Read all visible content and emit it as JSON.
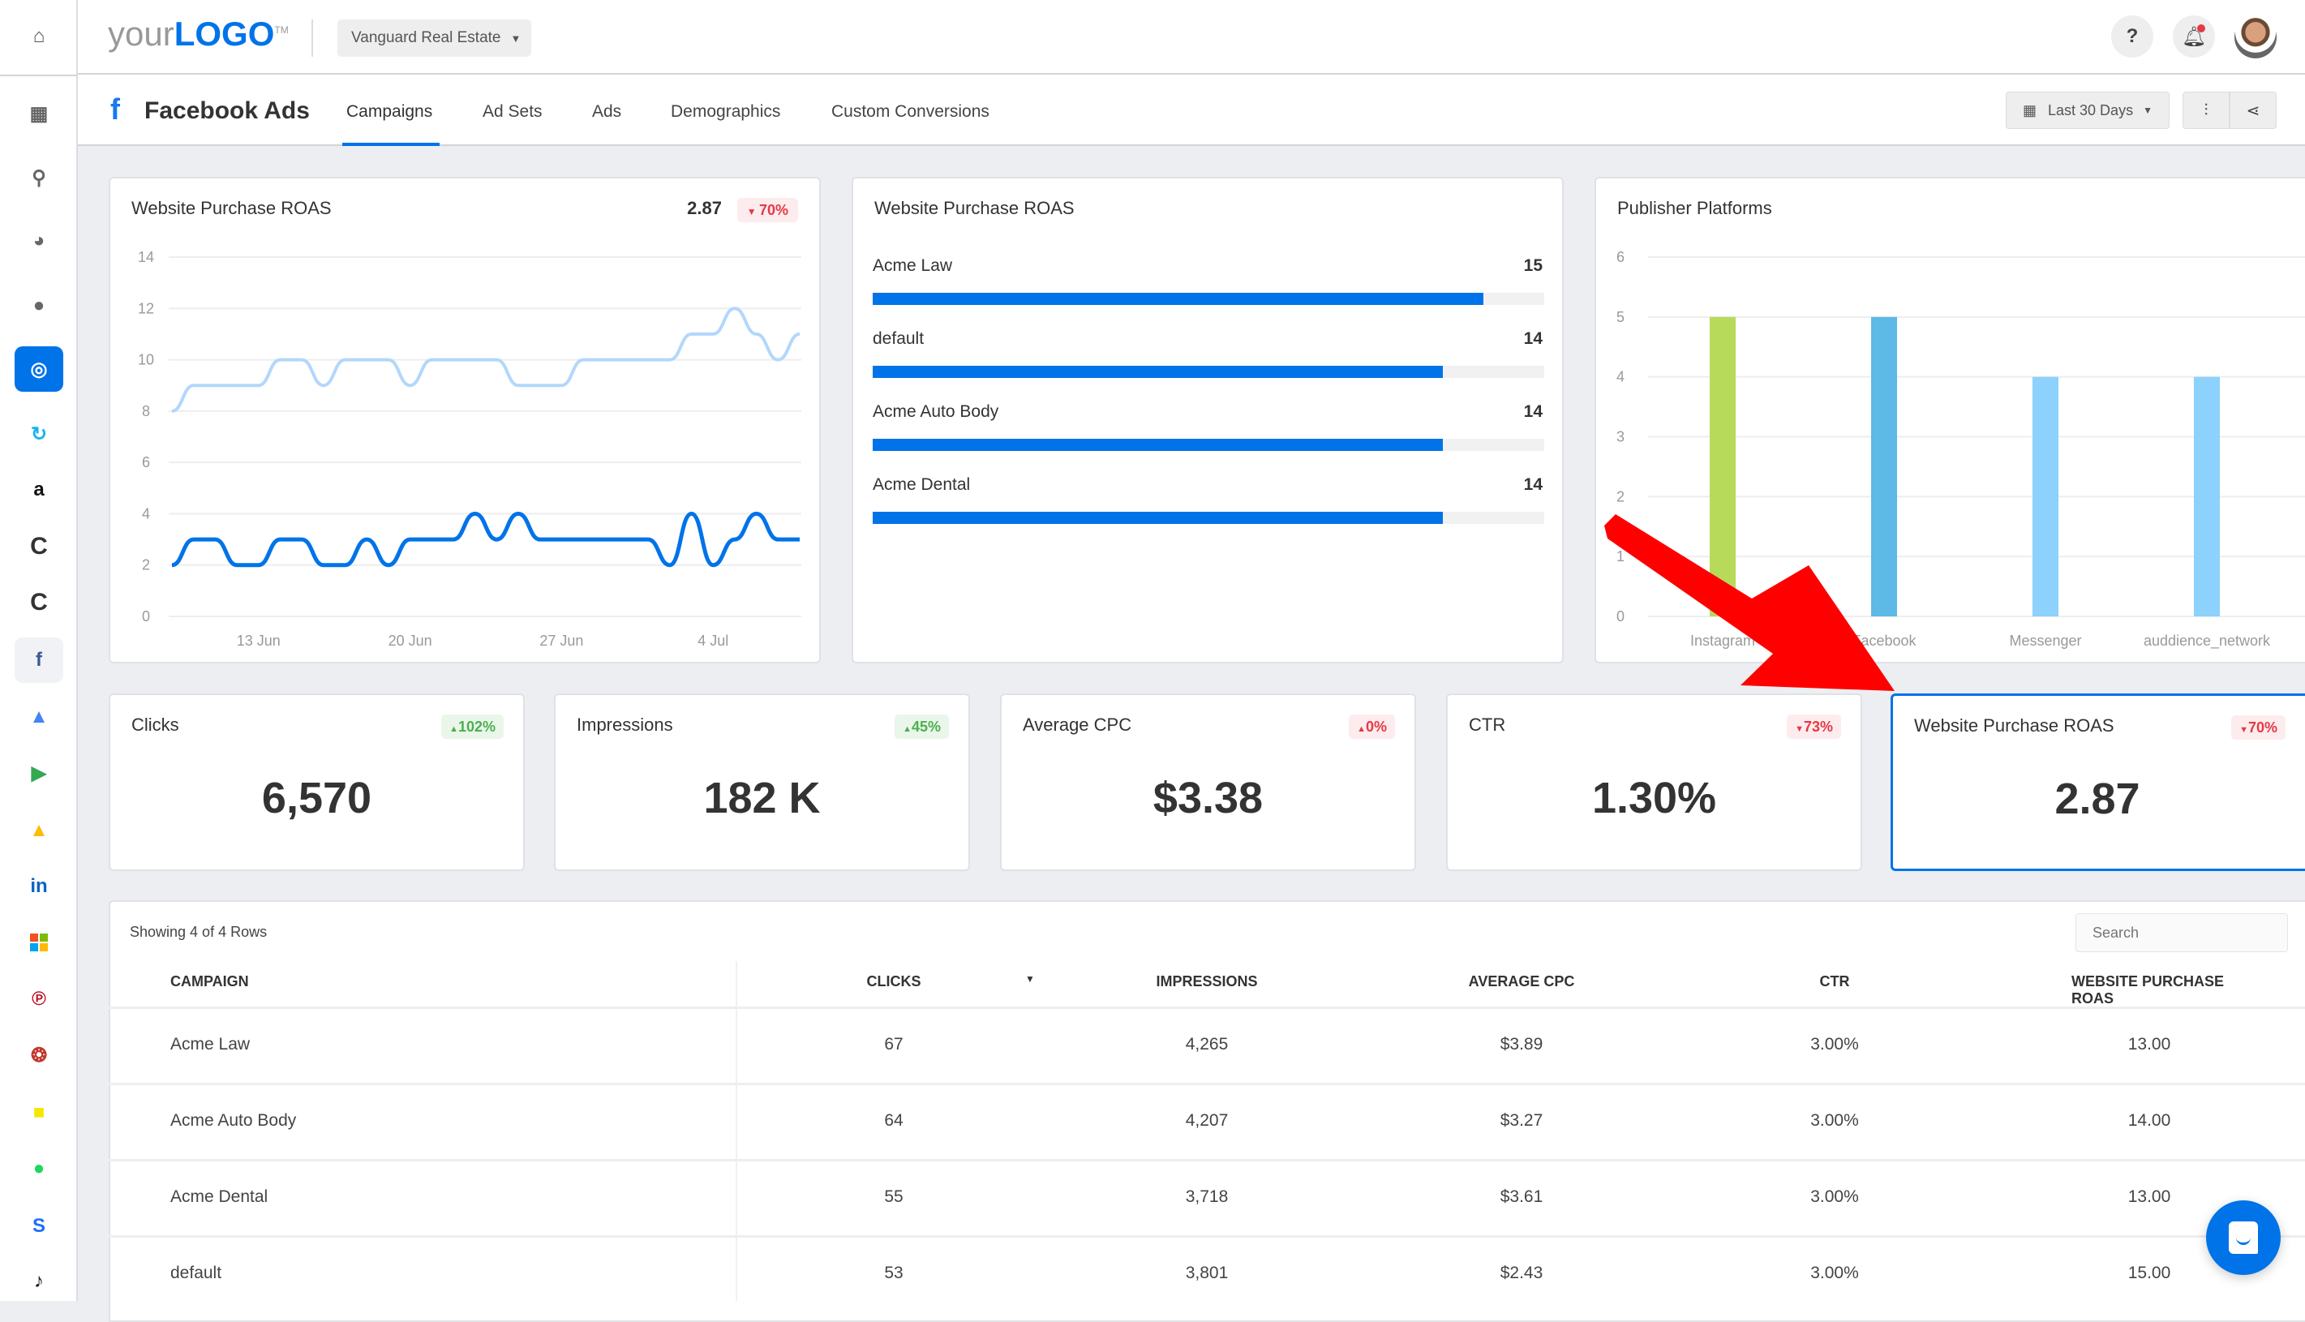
{
  "header": {
    "logo_your": "your",
    "logo_logo": "LOGO",
    "logo_tm": "TM",
    "client_select": "Vanguard Real Estate",
    "help": "?"
  },
  "subheader": {
    "title": "Facebook Ads",
    "tabs": [
      {
        "label": "Campaigns",
        "active": true
      },
      {
        "label": "Ad Sets"
      },
      {
        "label": "Ads"
      },
      {
        "label": "Demographics"
      },
      {
        "label": "Custom Conversions"
      }
    ],
    "date_range": "Last 30 Days"
  },
  "sidebar": {
    "items": [
      "home-icon",
      "grid-icon",
      "search-icon",
      "pie-chart-icon",
      "chat-icon",
      "target-icon",
      "ppc-icon",
      "amazon-icon",
      "callrail-icon",
      "callrail-icon-2",
      "facebook-icon",
      "google-ads-icon",
      "google-display-icon",
      "google-ads-icon-2",
      "linkedin-icon",
      "microsoft-icon",
      "pinterest-icon",
      "multicolor-icon",
      "snapchat-icon",
      "spotify-icon",
      "stackadapt-icon",
      "tiktok-icon"
    ],
    "active_index": 5,
    "selected_index": 10
  },
  "colors": {
    "accent": "#0073e9",
    "up": "#4caf50",
    "down": "#e53945",
    "annotation_arrow": "#ff0000"
  },
  "line_card": {
    "title": "Website Purchase ROAS",
    "value": "2.87",
    "change": "70%",
    "direction": "down"
  },
  "bar_card": {
    "title": "Website Purchase ROAS"
  },
  "platform_card": {
    "title": "Publisher Platforms"
  },
  "chart_data": [
    {
      "type": "line",
      "title": "Website Purchase ROAS",
      "ylim": [
        0,
        14
      ],
      "yticks": [
        "0",
        "2",
        "4",
        "6",
        "8",
        "10",
        "12",
        "14"
      ],
      "xticks": [
        "13 Jun",
        "20 Jun",
        "27 Jun",
        "4 Jul"
      ],
      "x": [
        "9 Jun",
        "10 Jun",
        "11 Jun",
        "12 Jun",
        "13 Jun",
        "14 Jun",
        "15 Jun",
        "16 Jun",
        "17 Jun",
        "18 Jun",
        "19 Jun",
        "20 Jun",
        "21 Jun",
        "22 Jun",
        "23 Jun",
        "24 Jun",
        "25 Jun",
        "26 Jun",
        "27 Jun",
        "28 Jun",
        "29 Jun",
        "30 Jun",
        "1 Jul",
        "2 Jul",
        "3 Jul",
        "4 Jul",
        "5 Jul",
        "6 Jul",
        "7 Jul",
        "8 Jul"
      ],
      "series": [
        {
          "color": "#b3d7fb",
          "values": [
            8,
            9,
            9,
            9,
            9,
            10,
            10,
            9,
            10,
            10,
            10,
            9,
            10,
            10,
            10,
            10,
            9,
            9,
            9,
            10,
            10,
            10,
            10,
            10,
            11,
            11,
            12,
            11,
            10,
            11
          ]
        },
        {
          "color": "#0073e9",
          "values": [
            2,
            3,
            3,
            2,
            2,
            3,
            3,
            2,
            2,
            3,
            2,
            3,
            3,
            3,
            4,
            3,
            4,
            3,
            3,
            3,
            3,
            3,
            3,
            2,
            4,
            2,
            3,
            4,
            3,
            3
          ]
        }
      ]
    },
    {
      "type": "bar",
      "orientation": "horizontal",
      "title": "Website Purchase ROAS",
      "categories": [
        "Acme Law",
        "default",
        "Acme Auto Body",
        "Acme Dental"
      ],
      "values": [
        15,
        14,
        14,
        14
      ],
      "color": "#0073e9"
    },
    {
      "type": "bar",
      "title": "Publisher Platforms",
      "ylim": [
        0,
        6
      ],
      "yticks": [
        "0",
        "1",
        "2",
        "3",
        "4",
        "5",
        "6"
      ],
      "categories": [
        "Instagram",
        "Facebook",
        "Messenger",
        "auddience_network"
      ],
      "values": [
        5,
        5,
        4,
        4
      ],
      "colors": [
        "#b8da5a",
        "#5db9e6",
        "#8dd1fd",
        "#8dd1fd"
      ]
    }
  ],
  "kpis": [
    {
      "label": "Clicks",
      "value": "6,570",
      "change": "102%",
      "direction": "up"
    },
    {
      "label": "Impressions",
      "value": "182 K",
      "change": "45%",
      "direction": "up"
    },
    {
      "label": "Average CPC",
      "value": "$3.38",
      "change": "0%",
      "direction": "up-negative"
    },
    {
      "label": "CTR",
      "value": "1.30%",
      "change": "73%",
      "direction": "down"
    },
    {
      "label": "Website Purchase ROAS",
      "value": "2.87",
      "change": "70%",
      "direction": "down",
      "selected": true
    }
  ],
  "table": {
    "showing": "Showing 4 of 4 Rows",
    "search_placeholder": "Search",
    "columns": [
      "CAMPAIGN",
      "CLICKS",
      "IMPRESSIONS",
      "AVERAGE CPC",
      "CTR",
      "WEBSITE PURCHASE ROAS"
    ],
    "sort_column": "CLICKS",
    "sort_direction": "desc",
    "rows": [
      [
        "Acme Law",
        "67",
        "4,265",
        "$3.89",
        "3.00%",
        "13.00"
      ],
      [
        "Acme Auto Body",
        "64",
        "4,207",
        "$3.27",
        "3.00%",
        "14.00"
      ],
      [
        "Acme Dental",
        "55",
        "3,718",
        "$3.61",
        "3.00%",
        "13.00"
      ],
      [
        "default",
        "53",
        "3,801",
        "$2.43",
        "3.00%",
        "15.00"
      ]
    ]
  }
}
